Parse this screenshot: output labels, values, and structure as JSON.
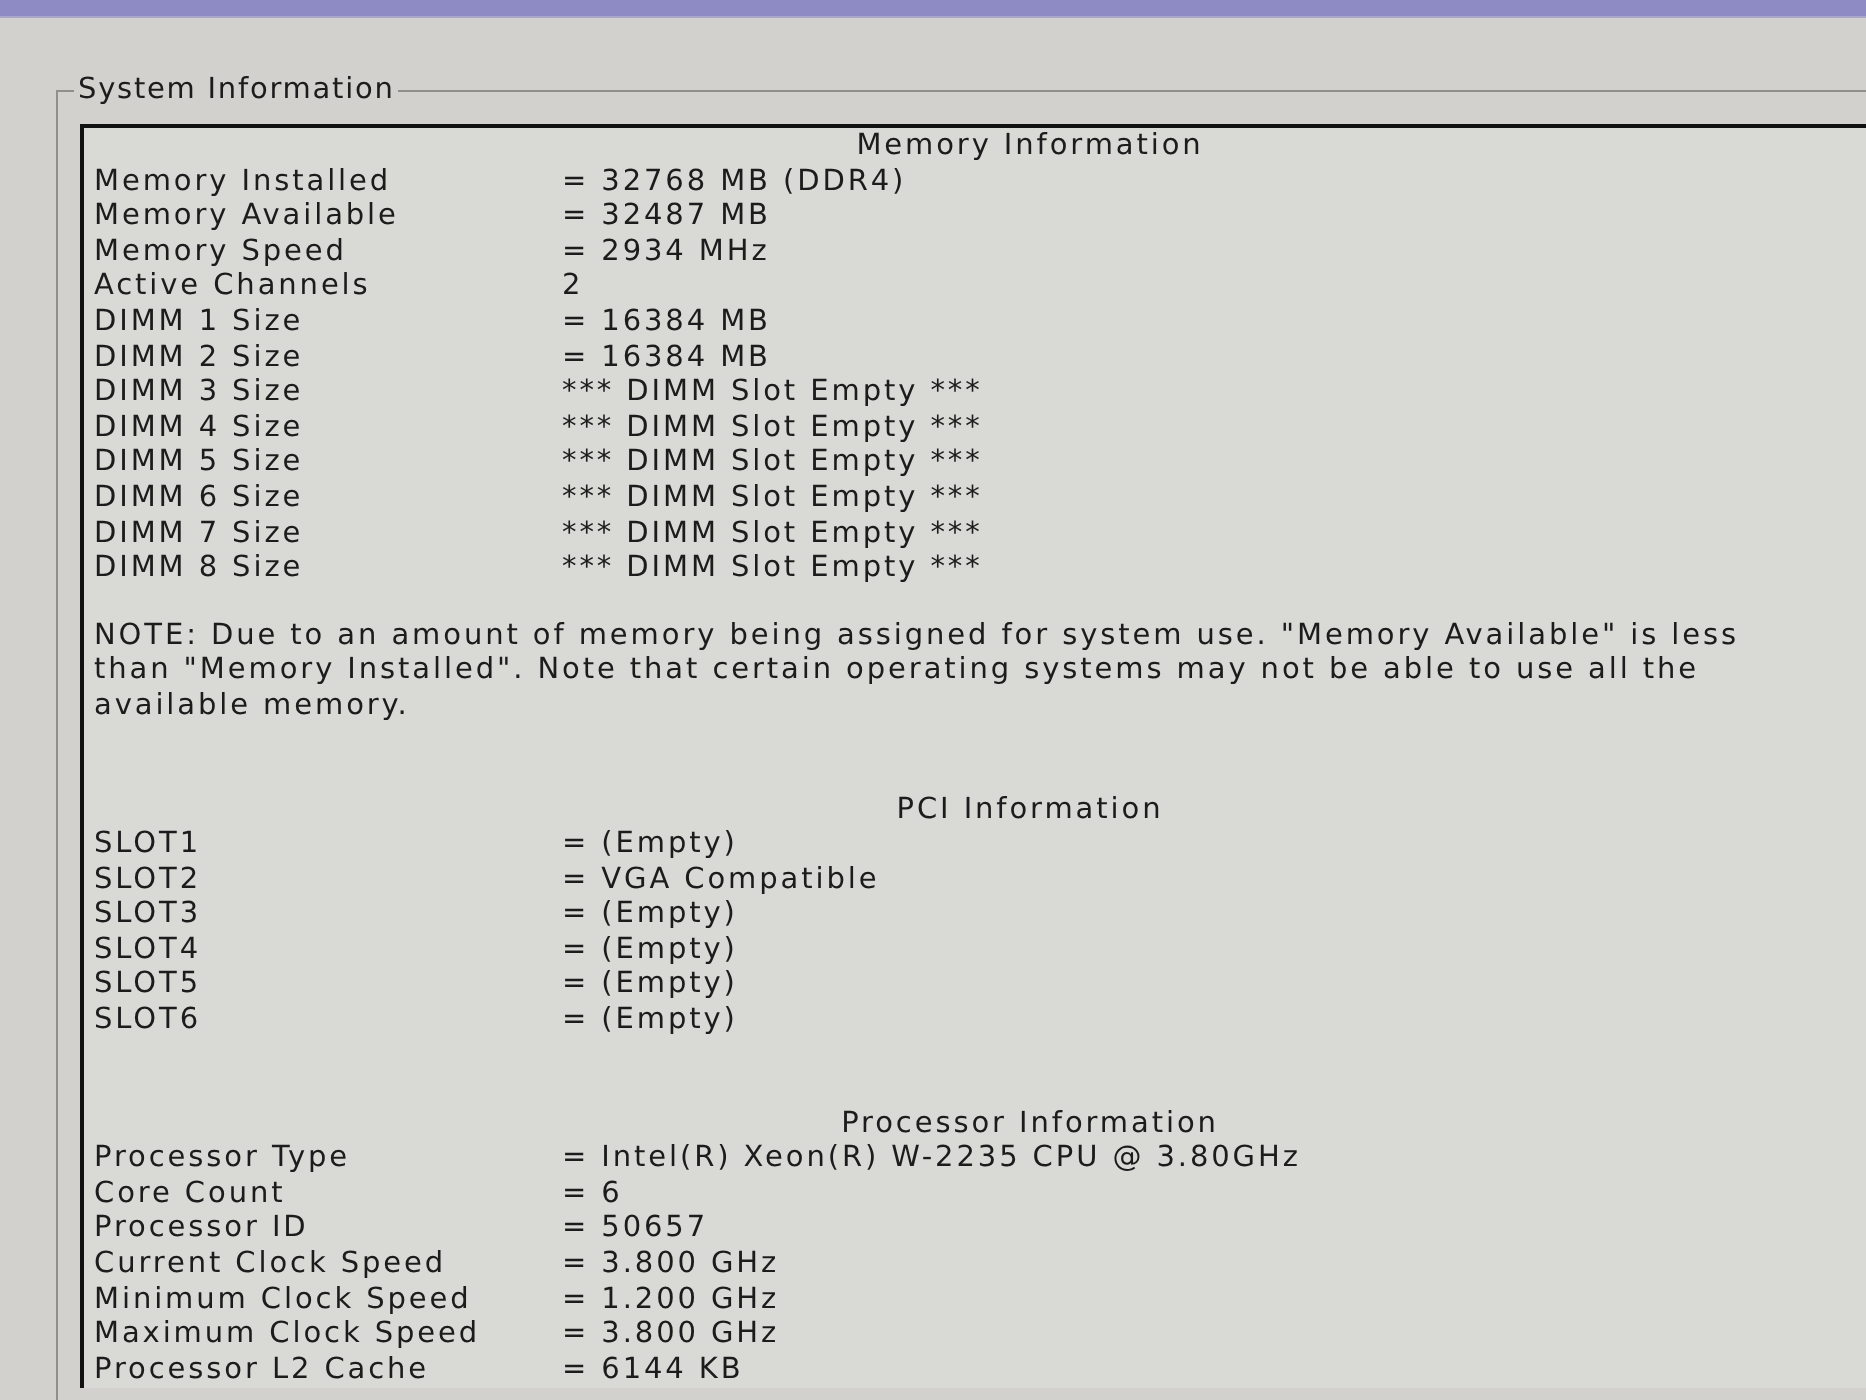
{
  "group_box": {
    "title": "System Information"
  },
  "sections": [
    {
      "heading": "Memory Information",
      "rows": [
        {
          "label": "Memory Installed",
          "value": "= 32768 MB (DDR4)"
        },
        {
          "label": "Memory Available",
          "value": "= 32487 MB"
        },
        {
          "label": "Memory Speed",
          "value": "= 2934 MHz"
        },
        {
          "label": "Active Channels",
          "value": "2"
        },
        {
          "label": "DIMM 1 Size",
          "value": "= 16384 MB"
        },
        {
          "label": "DIMM 2 Size",
          "value": "= 16384 MB"
        },
        {
          "label": "DIMM 3 Size",
          "value": "*** DIMM Slot Empty ***"
        },
        {
          "label": "DIMM 4 Size",
          "value": "*** DIMM Slot Empty ***"
        },
        {
          "label": "DIMM 5 Size",
          "value": "*** DIMM Slot Empty ***"
        },
        {
          "label": "DIMM 6 Size",
          "value": "*** DIMM Slot Empty ***"
        },
        {
          "label": "DIMM 7 Size",
          "value": "*** DIMM Slot Empty ***"
        },
        {
          "label": "DIMM 8 Size",
          "value": "*** DIMM Slot Empty ***"
        }
      ],
      "note": "NOTE: Due to an amount of memory being assigned for system use. \"Memory Available\" is less than \"Memory Installed\". Note that certain operating systems may not be able to use all the available memory."
    },
    {
      "heading": "PCI Information",
      "rows": [
        {
          "label": "SLOT1",
          "value": "= (Empty)"
        },
        {
          "label": "SLOT2",
          "value": "= VGA Compatible"
        },
        {
          "label": "SLOT3",
          "value": "= (Empty)"
        },
        {
          "label": "SLOT4",
          "value": "= (Empty)"
        },
        {
          "label": "SLOT5",
          "value": "= (Empty)"
        },
        {
          "label": "SLOT6",
          "value": "= (Empty)"
        }
      ]
    },
    {
      "heading": "Processor Information",
      "rows": [
        {
          "label": "Processor Type",
          "value": "= Intel(R) Xeon(R) W-2235 CPU @ 3.80GHz"
        },
        {
          "label": "Core Count",
          "value": "= 6"
        },
        {
          "label": "Processor ID",
          "value": "= 50657"
        },
        {
          "label": "Current Clock Speed",
          "value": "= 3.800 GHz"
        },
        {
          "label": "Minimum Clock Speed",
          "value": "= 1.200 GHz"
        },
        {
          "label": "Maximum Clock Speed",
          "value": "= 3.800 GHz"
        },
        {
          "label": "Processor L2 Cache",
          "value": "= 6144 KB"
        }
      ]
    }
  ]
}
